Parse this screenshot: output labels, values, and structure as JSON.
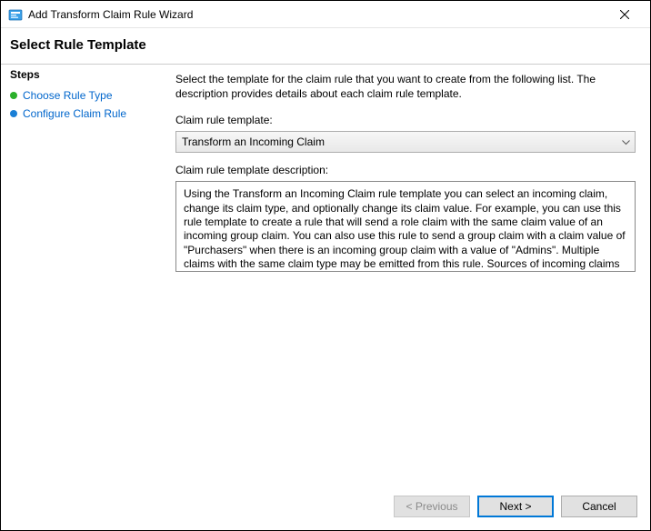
{
  "window": {
    "title": "Add Transform Claim Rule Wizard"
  },
  "header": {
    "title": "Select Rule Template"
  },
  "sidebar": {
    "heading": "Steps",
    "steps": [
      {
        "label": "Choose Rule Type"
      },
      {
        "label": "Configure Claim Rule"
      }
    ]
  },
  "main": {
    "instruction": "Select the template for the claim rule that you want to create from the following list. The description provides details about each claim rule template.",
    "template_label": "Claim rule template:",
    "template_selected": "Transform an Incoming Claim",
    "description_label": "Claim rule template description:",
    "description_text": "Using the Transform an Incoming Claim rule template you can select an incoming claim, change its claim type, and optionally change its claim value.  For example, you can use this rule template to create a rule that will send a role claim with the same claim value of an incoming group claim.  You can also use this rule to send a group claim with a claim value of \"Purchasers\" when there is an incoming group claim with a value of \"Admins\".  Multiple claims with the same claim type may be emitted from this rule.  Sources of incoming claims vary based on the rules being edited."
  },
  "footer": {
    "previous": "< Previous",
    "next": "Next >",
    "cancel": "Cancel"
  }
}
